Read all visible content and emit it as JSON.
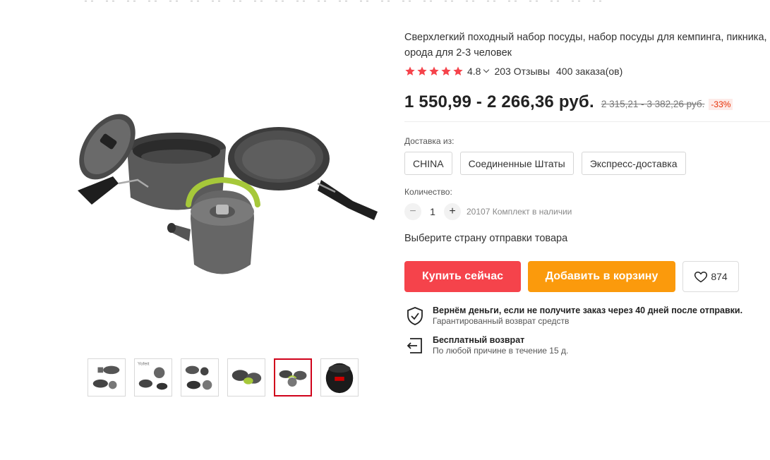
{
  "product": {
    "title": "Сверхлегкий походный набор посуды, набор посуды для кемпинга, пикника, орода для 2-3 человек",
    "rating": "4.8",
    "reviews": "203 Отзывы",
    "orders": "400 заказа(ов)",
    "price": "1 550,99 - 2 266,36 руб.",
    "old_price": "2 315,21 - 3 382,26 руб.",
    "discount": "-33%"
  },
  "shipping": {
    "label": "Доставка из:",
    "options": [
      "CHINA",
      "Соединенные Штаты",
      "Экспресс-доставка"
    ]
  },
  "quantity": {
    "label": "Количество:",
    "minus": "−",
    "plus": "+",
    "value": "1",
    "stock": "20107 Комплект в наличии"
  },
  "hint": "Выберите страну отправки товара",
  "buttons": {
    "buy": "Купить сейчас",
    "cart": "Добавить в корзину",
    "wishlist_count": "874"
  },
  "guarantee": {
    "title": "Вернём деньги, если не получите заказ через 40 дней после отправки.",
    "subtitle": "Гарантированный возврат средств"
  },
  "returns": {
    "title": "Бесплатный возврат",
    "subtitle": "По любой причине в течение 15 д."
  },
  "thumbnails": {
    "count": 6,
    "active_index": 4
  },
  "colors": {
    "buy": "#f5434b",
    "cart": "#fb9a0c",
    "star": "#f5434b",
    "discount": "#e62e04"
  },
  "icons": [
    "star-icon",
    "chevron-down-icon",
    "heart-icon",
    "shield-check-icon",
    "return-icon"
  ]
}
